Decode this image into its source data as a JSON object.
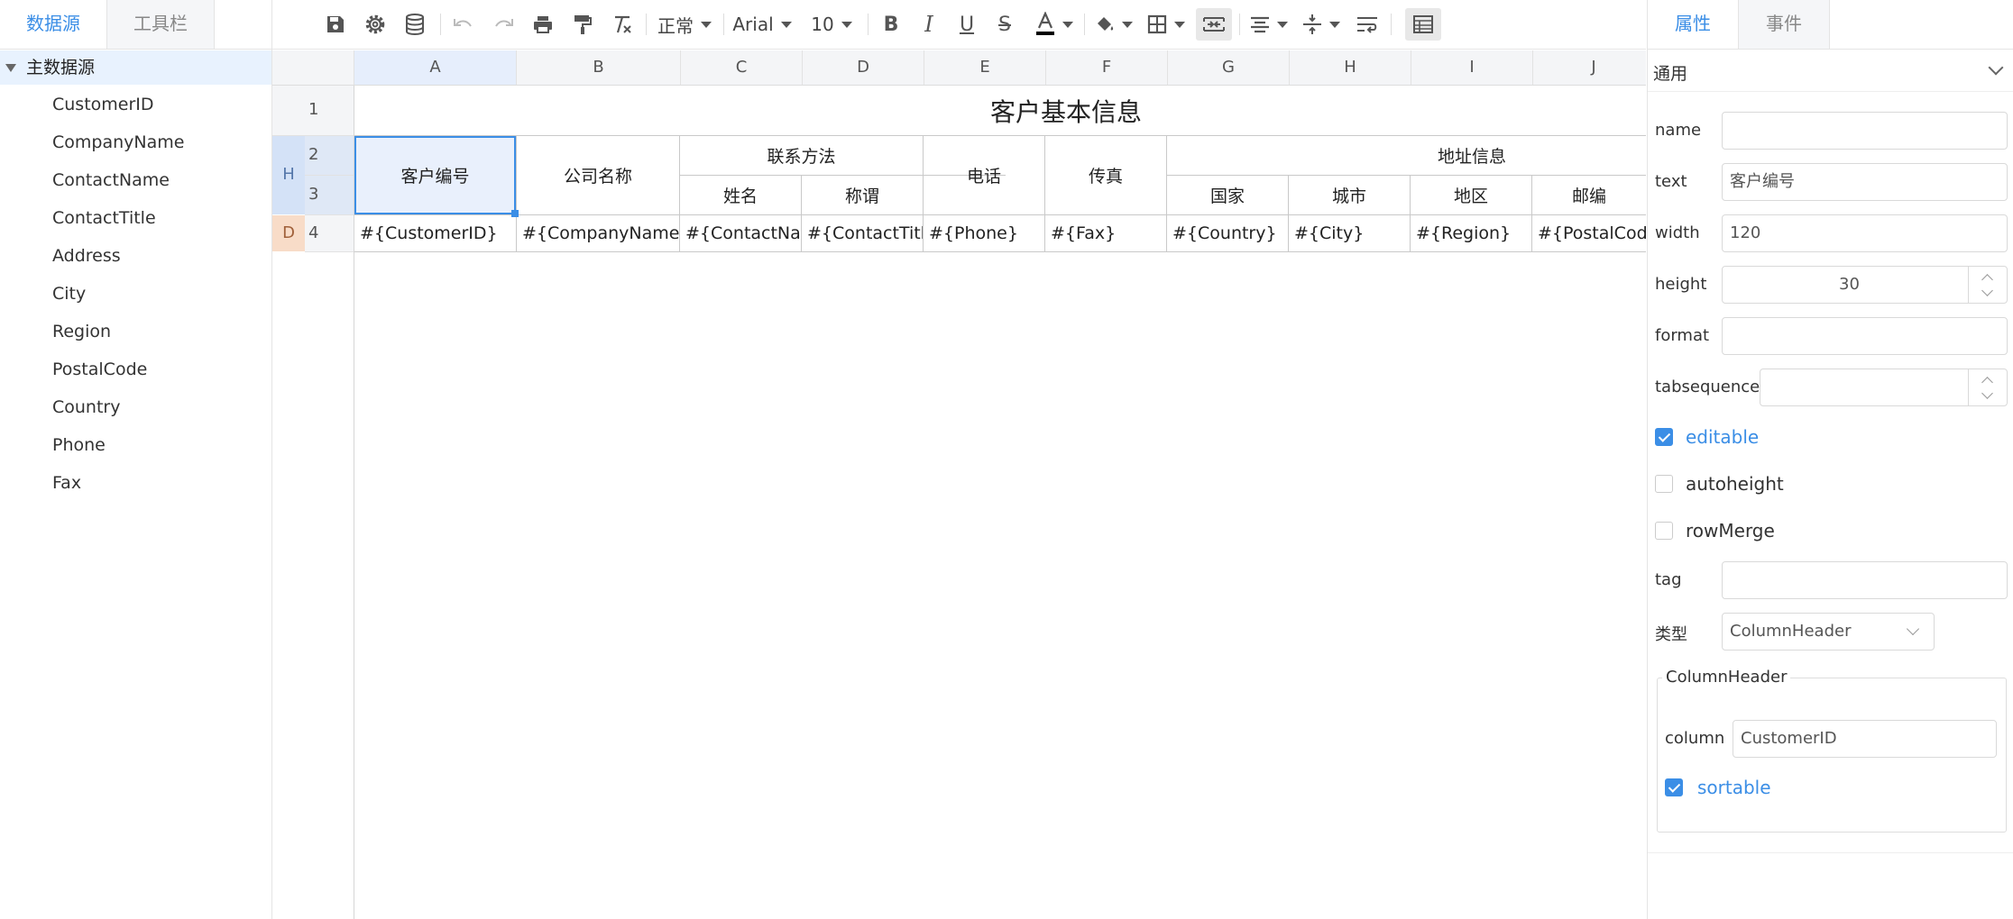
{
  "left_panel": {
    "tabs": [
      "数据源",
      "工具栏"
    ],
    "tree_root": "主数据源",
    "fields": [
      "CustomerID",
      "CompanyName",
      "ContactName",
      "ContactTitle",
      "Address",
      "City",
      "Region",
      "PostalCode",
      "Country",
      "Phone",
      "Fax"
    ]
  },
  "toolbar": {
    "style_select": "正常",
    "font_select": "Arial",
    "size_select": "10",
    "icons": [
      "save-icon",
      "settings-icon",
      "database-icon",
      "undo-icon",
      "redo-icon",
      "print-icon",
      "format-painter-icon",
      "clear-format-icon",
      "bold-icon",
      "italic-icon",
      "underline-icon",
      "strikethrough-icon",
      "font-color-icon",
      "fill-color-icon",
      "border-icon",
      "merge-cells-icon",
      "horizontal-align-icon",
      "vertical-align-icon",
      "wrap-text-icon",
      "table-icon"
    ],
    "font_color": "#000000"
  },
  "grid": {
    "columns": [
      "A",
      "B",
      "C",
      "D",
      "E",
      "F",
      "G",
      "H",
      "I",
      "J"
    ],
    "rows": [
      "1",
      "2",
      "3",
      "4"
    ],
    "row_bands": {
      "header": "H",
      "detail": "D"
    },
    "title": "客户基本信息",
    "header_row1": [
      "客户编号",
      "公司名称",
      "联系方法",
      "电话",
      "传真",
      "地址信息"
    ],
    "header_row2": [
      "姓名",
      "称谓",
      "国家",
      "城市",
      "地区",
      "邮编"
    ],
    "detail_row": [
      "#{CustomerID}",
      "#{CompanyName}",
      "#{ContactName}",
      "#{ContactTitle}",
      "#{Phone}",
      "#{Fax}",
      "#{Country}",
      "#{City}",
      "#{Region}",
      "#{PostalCode}"
    ],
    "colors": {
      "selection": "#3b8ee6",
      "header_band": "#d4e2f7",
      "detail_band": "#f8dcc8"
    }
  },
  "right_panel": {
    "tabs": [
      "属性",
      "事件"
    ],
    "section": "通用",
    "props": {
      "name_label": "name",
      "name_value": "",
      "text_label": "text",
      "text_value": "客户编号",
      "width_label": "width",
      "width_value": "120",
      "height_label": "height",
      "height_value": "30",
      "format_label": "format",
      "format_value": "",
      "tabsequence_label": "tabsequence",
      "tabsequence_value": "",
      "editable_label": "editable",
      "editable_checked": true,
      "autoheight_label": "autoheight",
      "autoheight_checked": false,
      "rowmerge_label": "rowMerge",
      "rowmerge_checked": false,
      "tag_label": "tag",
      "tag_value": "",
      "type_label": "类型",
      "type_value": "ColumnHeader"
    },
    "column_header": {
      "legend": "ColumnHeader",
      "column_label": "column",
      "column_value": "CustomerID",
      "sortable_label": "sortable",
      "sortable_checked": true
    },
    "accent": "#3b8ee6"
  }
}
